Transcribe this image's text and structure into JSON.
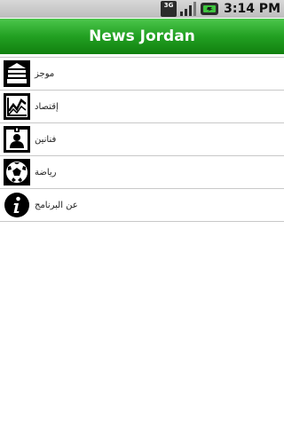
{
  "status_bar": {
    "network_type": "3G",
    "time": "3:14 PM",
    "icons": [
      "3g-icon",
      "signal-icon",
      "battery-icon"
    ]
  },
  "header": {
    "title": "News Jordan"
  },
  "menu": {
    "items": [
      {
        "label": "موجز",
        "icon": "news-brief-icon"
      },
      {
        "label": "إقتصاد",
        "icon": "economy-chart-icon"
      },
      {
        "label": "فنانين",
        "icon": "artist-badge-icon"
      },
      {
        "label": "رياضة",
        "icon": "soccer-ball-icon"
      },
      {
        "label": "عن البرنامج",
        "icon": "info-icon"
      }
    ]
  },
  "colors": {
    "title_bar": "#22a022",
    "title_text": "#ffffff",
    "divider": "#c8c8c8"
  }
}
